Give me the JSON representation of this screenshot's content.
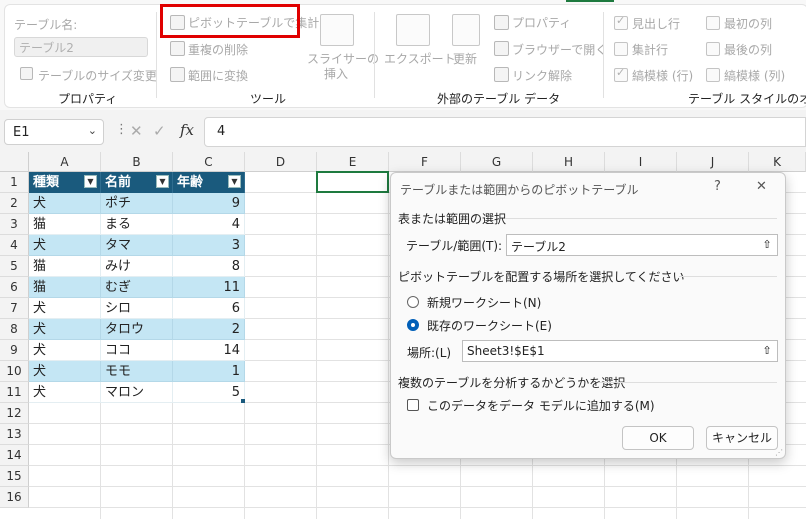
{
  "ribbon": {
    "table_name_label": "テーブル名:",
    "table_name_value": "テーブル2",
    "resize_table": "テーブルのサイズ変更",
    "group_properties": "プロパティ",
    "pivot_summary": "ピボットテーブルで集計",
    "remove_duplicates": "重複の削除",
    "convert_to_range": "範囲に変換",
    "insert_slicer": [
      "スライサーの",
      "挿入"
    ],
    "group_tools": "ツール",
    "export": "エクスポート",
    "refresh": "更新",
    "properties": "プロパティ",
    "open_in_browser": "ブラウザーで開く",
    "unlink": "リンク解除",
    "group_external": "外部のテーブル データ",
    "header_row": "見出し行",
    "total_row": "集計行",
    "banded_rows": "縞模様 (行)",
    "first_column": "最初の列",
    "last_column": "最後の列",
    "banded_columns": "縞模様 (列)",
    "group_style_options": "テーブル スタイルのオプション"
  },
  "formula_bar": {
    "name_box": "E1",
    "formula_value": "4",
    "fx": "fx",
    "cancel_glyph": "✕",
    "enter_glyph": "✓"
  },
  "grid": {
    "columns": [
      "A",
      "B",
      "C",
      "D",
      "E",
      "F",
      "G",
      "H",
      "I",
      "J",
      "K"
    ],
    "rows": [
      "1",
      "2",
      "3",
      "4",
      "5",
      "6",
      "7",
      "8",
      "9",
      "10",
      "11",
      "12",
      "13",
      "14",
      "15",
      "16"
    ],
    "headers": [
      "種類",
      "名前",
      "年齢"
    ],
    "data": [
      [
        "犬",
        "ポチ",
        "9"
      ],
      [
        "猫",
        "まる",
        "4"
      ],
      [
        "犬",
        "タマ",
        "3"
      ],
      [
        "猫",
        "みけ",
        "8"
      ],
      [
        "猫",
        "むぎ",
        "11"
      ],
      [
        "犬",
        "シロ",
        "6"
      ],
      [
        "犬",
        "タロウ",
        "2"
      ],
      [
        "犬",
        "ココ",
        "14"
      ],
      [
        "犬",
        "モモ",
        "1"
      ],
      [
        "犬",
        "マロン",
        "5"
      ]
    ],
    "header_color": "#1a5a7d",
    "band_color": "#c4e6f4"
  },
  "dialog": {
    "title": "テーブルまたは範囲からのピボットテーブル",
    "help": "?",
    "close": "✕",
    "section_select": "表または範囲の選択",
    "table_range_label": "テーブル/範囲(T):",
    "table_range_value": "テーブル2",
    "section_place": "ピボットテーブルを配置する場所を選択してください",
    "new_sheet": "新規ワークシート(N)",
    "existing_sheet": "既存のワークシート(E)",
    "location_label": "場所:(L)",
    "location_value": "Sheet3!$E$1",
    "section_multi": "複数のテーブルを分析するかどうかを選択",
    "add_to_model": "このデータをデータ モデルに追加する(M)",
    "ok": "OK",
    "cancel": "キャンセル",
    "collapse_glyph": "⇧"
  },
  "colors": {
    "highlight": "#e00000",
    "accent": "#005fb8",
    "excel_green": "#1e7a3f"
  }
}
